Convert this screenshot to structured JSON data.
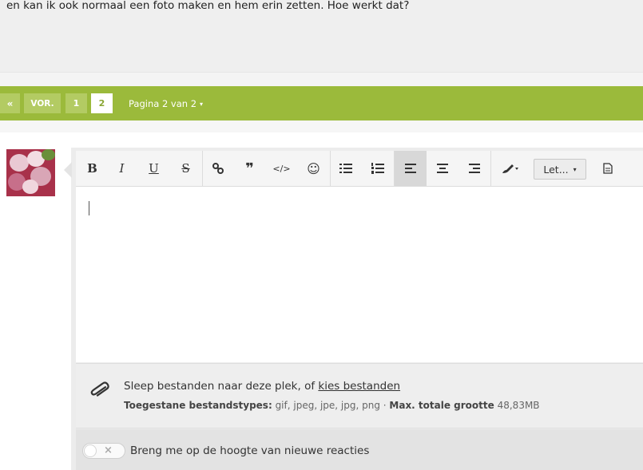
{
  "post": {
    "text": "en kan ik ook normaal een foto maken en hem erin zetten. Hoe werkt dat?"
  },
  "pagination": {
    "first_label": "«",
    "prev_label": "VOR.",
    "pages": [
      "1",
      "2"
    ],
    "current_page": "2",
    "page_info": "Pagina 2 van 2",
    "caret": "▾"
  },
  "toolbar": {
    "bold": "B",
    "italic": "I",
    "underline": "U",
    "strike": "S",
    "link": "%",
    "quote": "❞",
    "code": "</>",
    "emoji": "☺",
    "font_label": "Let...",
    "font_caret": "▾",
    "icons": [
      "bold-icon",
      "italic-icon",
      "underline-icon",
      "strikethrough-icon",
      "link-icon",
      "quote-icon",
      "code-icon",
      "smiley-icon",
      "bullet-list-icon",
      "numbered-list-icon",
      "align-left-icon",
      "align-center-icon",
      "align-right-icon",
      "brush-icon",
      "font-dropdown",
      "draft-icon"
    ]
  },
  "attachments": {
    "drop_text": "Sleep bestanden naar deze plek, of ",
    "choose_link": "kies bestanden",
    "allowed_label": "Toegestane bestandstypes:",
    "allowed_types": " gif, jpeg, jpe, jpg, png · ",
    "max_label": "Max. totale grootte",
    "max_value": " 48,83MB"
  },
  "notify": {
    "label": "Breng me op de hoogte van nieuwe reacties",
    "toggle_state": "off",
    "toggle_symbol": "×"
  },
  "colors": {
    "pager_green": "#9bba3b",
    "pager_button": "#b3cb63"
  }
}
